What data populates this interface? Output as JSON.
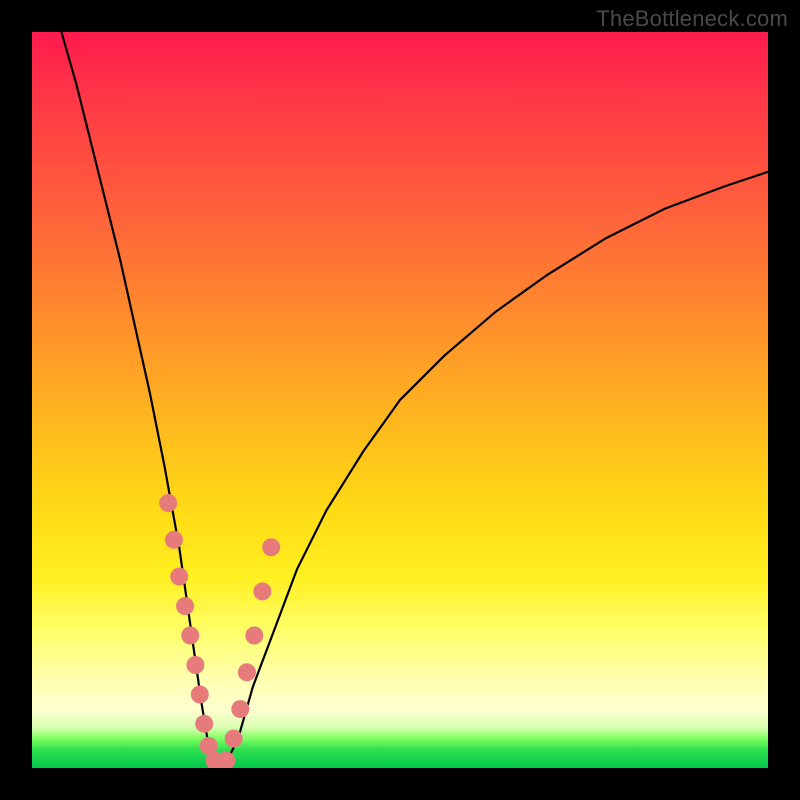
{
  "watermark": "TheBottleneck.com",
  "chart_data": {
    "type": "line",
    "title": "",
    "xlabel": "",
    "ylabel": "",
    "xlim": [
      0,
      100
    ],
    "ylim": [
      0,
      100
    ],
    "series": [
      {
        "name": "bottleneck-curve",
        "x": [
          4,
          6,
          8,
          10,
          12,
          14,
          16,
          18,
          20,
          21,
          22,
          23,
          24,
          25,
          26,
          28,
          30,
          33,
          36,
          40,
          45,
          50,
          56,
          63,
          70,
          78,
          86,
          94,
          100
        ],
        "values": [
          100,
          93,
          85,
          77,
          69,
          60,
          51,
          41,
          30,
          23,
          16,
          9,
          3,
          0,
          0,
          4,
          11,
          19,
          27,
          35,
          43,
          50,
          56,
          62,
          67,
          72,
          76,
          79,
          81
        ]
      }
    ],
    "markers": {
      "name": "highlight-points",
      "color": "#e77a7a",
      "x": [
        18.5,
        19.3,
        20.0,
        20.8,
        21.5,
        22.2,
        22.8,
        23.4,
        24.0,
        24.8,
        25.6,
        26.4,
        27.4,
        28.3,
        29.2,
        30.2,
        31.3,
        32.5
      ],
      "values": [
        36,
        31,
        26,
        22,
        18,
        14,
        10,
        6,
        3,
        1,
        0,
        1,
        4,
        8,
        13,
        18,
        24,
        30
      ]
    },
    "background_gradient": {
      "top": "#ff1a4d",
      "mid": "#ffe030",
      "bottom": "#00c84a"
    }
  }
}
